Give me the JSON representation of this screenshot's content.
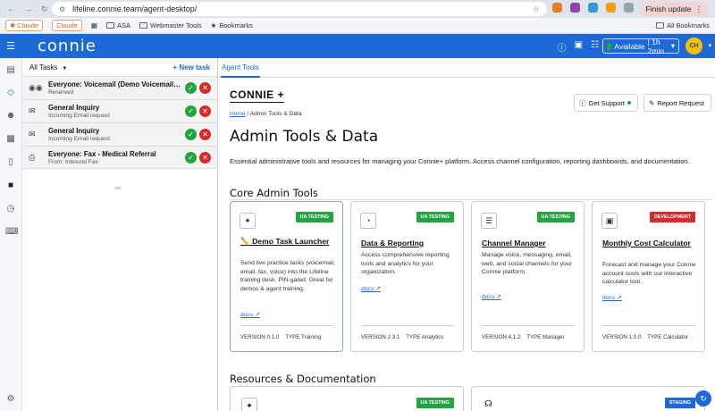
{
  "browser": {
    "url": "lifeline.connie.team/agent-desktop/",
    "finish_update": "Finish update",
    "bookmarks": [
      {
        "label": "Claude"
      },
      {
        "label": "Claude"
      },
      {
        "label": "ASA"
      },
      {
        "label": "Webmaster Tools"
      },
      {
        "label": "Bookmarks"
      }
    ],
    "all_bookmarks": "All Bookmarks"
  },
  "header": {
    "logo": "connie",
    "status": "Available",
    "timer": "| 1h 2min",
    "avatar_initials": "CH",
    "accent": "#1d6ad6"
  },
  "tasks": {
    "filter": "All Tasks",
    "new_task": "+ New task",
    "items": [
      {
        "icon": "voicemail-icon",
        "title": "Everyone: Voicemail (Demo Voicemail Cal...",
        "subtitle": "Reserved"
      },
      {
        "icon": "email-icon",
        "title": "General Inquiry",
        "subtitle": "Incoming Email request"
      },
      {
        "icon": "email-icon",
        "title": "General Inquiry",
        "subtitle": "Incoming Email request"
      },
      {
        "icon": "fax-icon",
        "title": "Everyone: Fax - Medical Referral",
        "subtitle": "From: Inbound Fax"
      }
    ]
  },
  "main": {
    "tab": "Agent Tools",
    "brand": "CONNIE +",
    "support": "Get Support",
    "report": "Report Request",
    "breadcrumb_home": "Home",
    "breadcrumb_rest": " / Admin Tools & Data",
    "title": "Admin Tools & Data",
    "description": "Essential administrative tools and resources for managing your Connie+ platform. Access channel configuration, reporting dashboards, and documentation.",
    "section1": "Core Admin Tools",
    "section2": "Resources & Documentation",
    "cards": [
      {
        "title": "✏️ Demo Task Launcher",
        "badge": "UA TESTING",
        "badge_color": "green",
        "desc": "Send live practice tasks (voicemail, email, fax, voice) into the Lifeline training desk. PIN-gated. Great for demos & agent training.",
        "docs": "docs ↗",
        "version": "VERSION 0.1.0",
        "type": "TYPE Training"
      },
      {
        "title": "Data & Reporting",
        "badge": "UA TESTING",
        "badge_color": "green",
        "desc": "Access comprehensive reporting tools and analytics for your organization.",
        "docs": "docs ↗",
        "version": "VERSION 2.3.1",
        "type": "TYPE Analytics"
      },
      {
        "title": "Channel Manager",
        "badge": "UA TESTING",
        "badge_color": "green",
        "desc": "Manage voice, messaging, email, web, and social channels for your Connie platform.",
        "docs": "docs ↗",
        "version": "VERSION 4.1.2",
        "type": "TYPE Manager"
      },
      {
        "title": "Monthly Cost Calculator",
        "badge": "DEVELOPMENT",
        "badge_color": "red",
        "desc": "Forecast and manage your Connie account costs with our interactive calculator tool.",
        "docs": "docs ↗",
        "version": "VERSION 1.0.0",
        "type": "TYPE Calculator"
      }
    ],
    "resource_badges": [
      "UA TESTING",
      "STAGING"
    ]
  }
}
